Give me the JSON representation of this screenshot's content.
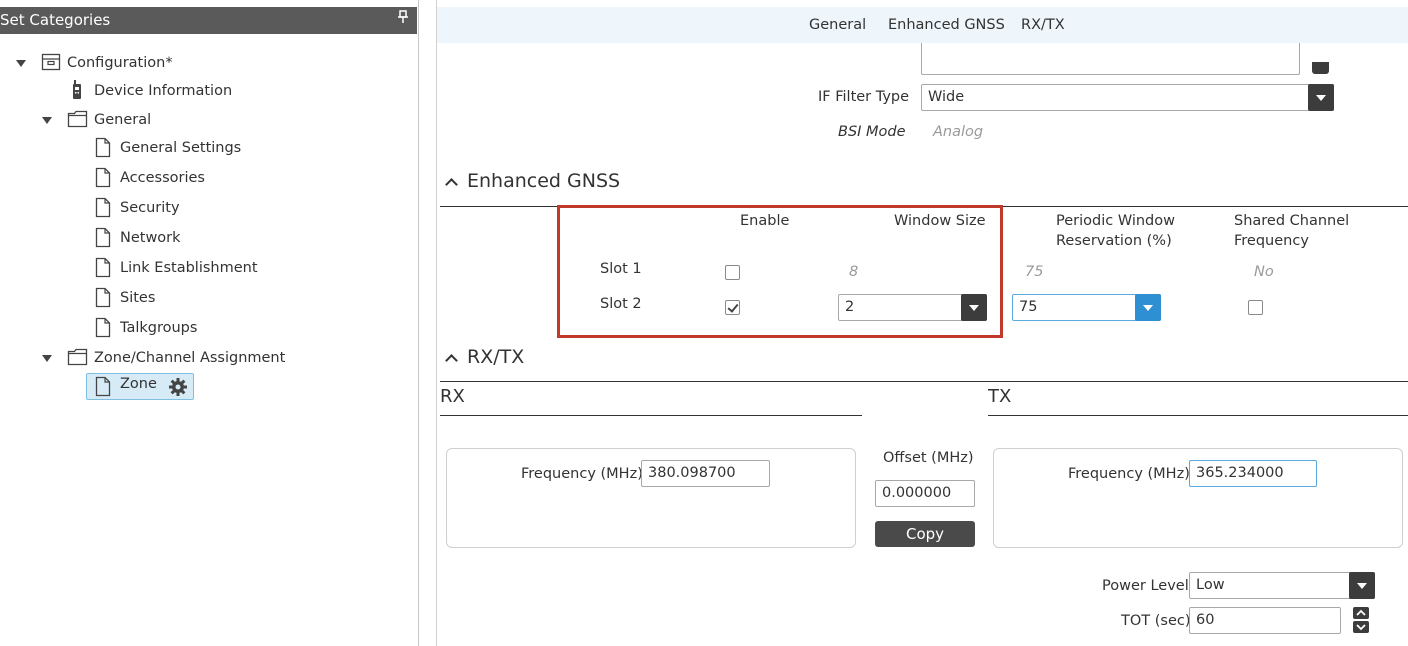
{
  "left_panel": {
    "title": "Set Categories",
    "tree": [
      {
        "label": "Configuration*",
        "icon": "archive-icon"
      },
      {
        "label": "Device Information",
        "icon": "radio-icon"
      },
      {
        "label": "General",
        "icon": "folder-icon"
      },
      {
        "label": "General Settings",
        "icon": "document-icon"
      },
      {
        "label": "Accessories",
        "icon": "document-icon"
      },
      {
        "label": "Security",
        "icon": "document-icon"
      },
      {
        "label": "Network",
        "icon": "document-icon"
      },
      {
        "label": "Link Establishment",
        "icon": "document-icon"
      },
      {
        "label": "Sites",
        "icon": "document-icon"
      },
      {
        "label": "Talkgroups",
        "icon": "document-icon"
      },
      {
        "label": "Zone/Channel Assignment",
        "icon": "folder-icon"
      },
      {
        "label": "Zone",
        "icon": "document-icon",
        "selected": true
      }
    ]
  },
  "tabs": [
    "General",
    "Enhanced GNSS",
    "RX/TX"
  ],
  "general": {
    "if_filter_label": "IF Filter Type",
    "if_filter_value": "Wide",
    "bsi_mode_label": "BSI Mode",
    "bsi_mode_value": "Analog"
  },
  "gnss": {
    "title": "Enhanced GNSS",
    "col_enable": "Enable",
    "col_window": "Window Size",
    "col_periodic_1": "Periodic Window",
    "col_periodic_2": "Reservation (%)",
    "col_shared_1": "Shared Channel",
    "col_shared_2": "Frequency",
    "slot1": {
      "label": "Slot 1",
      "enabled": false,
      "window": "8",
      "periodic": "75",
      "shared": "No"
    },
    "slot2": {
      "label": "Slot 2",
      "enabled": true,
      "window": "2",
      "periodic": "75",
      "shared": false
    }
  },
  "rxtx": {
    "title": "RX/TX",
    "rx_label": "RX",
    "tx_label": "TX",
    "rx_freq_label": "Frequency (MHz)",
    "rx_freq_value": "380.098700",
    "offset_label": "Offset (MHz)",
    "offset_value": "0.000000",
    "copy_label": "Copy",
    "tx_freq_label": "Frequency (MHz)",
    "tx_freq_value": "365.234000",
    "power_label": "Power Level",
    "power_value": "Low",
    "tot_label": "TOT (sec)",
    "tot_value": "60"
  },
  "colors": {
    "accent": "#2f8fd3",
    "highlight": "#c0392b",
    "header": "#5a5a5a",
    "selection": "#d6ebf6"
  }
}
